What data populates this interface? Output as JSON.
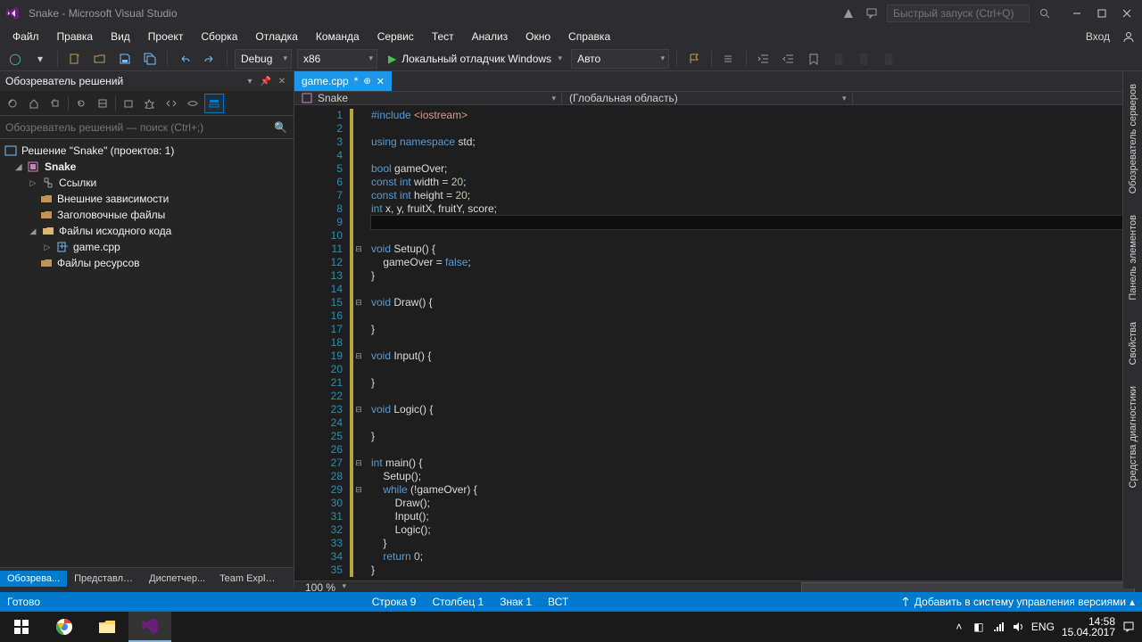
{
  "window": {
    "title": "Snake - Microsoft Visual Studio"
  },
  "titlebar": {
    "quick_launch_placeholder": "Быстрый запуск (Ctrl+Q)"
  },
  "menu": {
    "items": [
      "Файл",
      "Правка",
      "Вид",
      "Проект",
      "Сборка",
      "Отладка",
      "Команда",
      "Сервис",
      "Тест",
      "Анализ",
      "Окно",
      "Справка"
    ],
    "signin": "Вход"
  },
  "toolbar": {
    "config": "Debug",
    "platform": "x86",
    "start_label": "Локальный отладчик Windows",
    "scope": "Авто"
  },
  "solution_panel": {
    "title": "Обозреватель решений",
    "search_placeholder": "Обозреватель решений — поиск (Ctrl+;)",
    "tree": {
      "solution": "Решение \"Snake\" (проектов: 1)",
      "project": "Snake",
      "refs": "Ссылки",
      "external": "Внешние зависимости",
      "headers": "Заголовочные файлы",
      "sources": "Файлы исходного кода",
      "file": "game.cpp",
      "resources": "Файлы ресурсов"
    },
    "bottom_tabs": [
      "Обозрева...",
      "Представле...",
      "Диспетчер...",
      "Team Explorer"
    ]
  },
  "editor": {
    "tab_name": "game.cpp",
    "tab_dirty": "*",
    "nav_left": "Snake",
    "nav_mid": "(Глобальная область)",
    "nav_right": "",
    "total_lines": 35,
    "current_line": 9,
    "fold_lines": [
      11,
      15,
      19,
      23,
      27,
      29
    ],
    "code": [
      {
        "n": 1,
        "h": "<span class='tok-kw'>#include</span> <span class='tok-str'>&lt;iostream&gt;</span>"
      },
      {
        "n": 2,
        "h": ""
      },
      {
        "n": 3,
        "h": "<span class='tok-kw'>using</span> <span class='tok-kw'>namespace</span> std;"
      },
      {
        "n": 4,
        "h": ""
      },
      {
        "n": 5,
        "h": "<span class='tok-type'>bool</span> gameOver;"
      },
      {
        "n": 6,
        "h": "<span class='tok-kw'>const</span> <span class='tok-type'>int</span> width = <span class='tok-num'>20</span>;"
      },
      {
        "n": 7,
        "h": "<span class='tok-kw'>const</span> <span class='tok-type'>int</span> height = <span class='tok-num'>20</span>;"
      },
      {
        "n": 8,
        "h": "<span class='tok-type'>int</span> x, y, fruitX, fruitY, score;"
      },
      {
        "n": 9,
        "h": ""
      },
      {
        "n": 10,
        "h": ""
      },
      {
        "n": 11,
        "h": "<span class='tok-type'>void</span> Setup() {"
      },
      {
        "n": 12,
        "h": "    gameOver = <span class='tok-const'>false</span>;"
      },
      {
        "n": 13,
        "h": "}"
      },
      {
        "n": 14,
        "h": ""
      },
      {
        "n": 15,
        "h": "<span class='tok-type'>void</span> Draw() {"
      },
      {
        "n": 16,
        "h": ""
      },
      {
        "n": 17,
        "h": "}"
      },
      {
        "n": 18,
        "h": ""
      },
      {
        "n": 19,
        "h": "<span class='tok-type'>void</span> Input() {"
      },
      {
        "n": 20,
        "h": ""
      },
      {
        "n": 21,
        "h": "}"
      },
      {
        "n": 22,
        "h": ""
      },
      {
        "n": 23,
        "h": "<span class='tok-type'>void</span> Logic() {"
      },
      {
        "n": 24,
        "h": ""
      },
      {
        "n": 25,
        "h": "}"
      },
      {
        "n": 26,
        "h": ""
      },
      {
        "n": 27,
        "h": "<span class='tok-type'>int</span> main() {"
      },
      {
        "n": 28,
        "h": "    Setup();"
      },
      {
        "n": 29,
        "h": "    <span class='tok-kw'>while</span> (!gameOver) {"
      },
      {
        "n": 30,
        "h": "        Draw();"
      },
      {
        "n": 31,
        "h": "        Input();"
      },
      {
        "n": 32,
        "h": "        Logic();"
      },
      {
        "n": 33,
        "h": "    }"
      },
      {
        "n": 34,
        "h": "    <span class='tok-kw'>return</span> <span class='tok-num'>0</span>;"
      },
      {
        "n": 35,
        "h": "}"
      }
    ],
    "zoom": "100 %"
  },
  "right_tabs": [
    "Обозреватель серверов",
    "Панель элементов",
    "Свойства",
    "Средства диагностики"
  ],
  "status": {
    "ready": "Готово",
    "line": "Строка 9",
    "col": "Столбец 1",
    "char": "Знак 1",
    "ins": "ВСТ",
    "vc": "Добавить в систему управления версиями"
  },
  "taskbar": {
    "lang": "ENG",
    "time": "14:58",
    "date": "15.04.2017"
  }
}
